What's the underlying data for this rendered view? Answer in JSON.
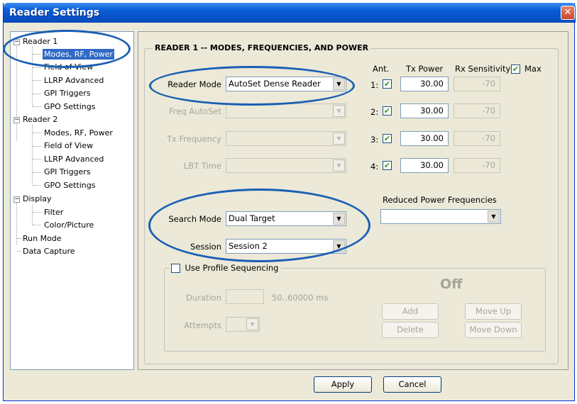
{
  "window": {
    "title": "Reader Settings",
    "close_glyph": "✕"
  },
  "tree": {
    "items": [
      {
        "label": "Reader 1",
        "expander": "−"
      },
      {
        "label": "Modes, RF, Power"
      },
      {
        "label": "Field of View"
      },
      {
        "label": "LLRP Advanced"
      },
      {
        "label": "GPI Triggers"
      },
      {
        "label": "GPO Settings"
      },
      {
        "label": "Reader 2",
        "expander": "−"
      },
      {
        "label": "Modes, RF, Power"
      },
      {
        "label": "Field of View"
      },
      {
        "label": "LLRP Advanced"
      },
      {
        "label": "GPI Triggers"
      },
      {
        "label": "GPO Settings"
      },
      {
        "label": "Display",
        "expander": "−"
      },
      {
        "label": "Filter"
      },
      {
        "label": "Color/Picture"
      },
      {
        "label": "Run Mode"
      },
      {
        "label": "Data Capture"
      }
    ],
    "selected": "Modes, RF, Power"
  },
  "group": {
    "title": "READER 1 -- MODES, FREQUENCIES, AND POWER"
  },
  "form": {
    "reader_mode": {
      "label": "Reader Mode",
      "value": "AutoSet Dense Reader"
    },
    "freq_autoset": {
      "label": "Freq AutoSet",
      "value": ""
    },
    "tx_frequency": {
      "label": "Tx Frequency",
      "value": ""
    },
    "lbt_time": {
      "label": "LBT Time",
      "value": ""
    },
    "search_mode": {
      "label": "Search Mode",
      "value": "Dual Target"
    },
    "session": {
      "label": "Session",
      "value": "Session 2"
    }
  },
  "antennas": {
    "header_ant": "Ant.",
    "header_tx": "Tx Power",
    "header_rx": "Rx Sensitivity",
    "max_label": "Max",
    "max_checked": true,
    "rows": [
      {
        "num": "1:",
        "checked": true,
        "tx": "30.00",
        "rx": "-70"
      },
      {
        "num": "2:",
        "checked": true,
        "tx": "30.00",
        "rx": "-70"
      },
      {
        "num": "3:",
        "checked": true,
        "tx": "30.00",
        "rx": "-70"
      },
      {
        "num": "4:",
        "checked": true,
        "tx": "30.00",
        "rx": "-70"
      }
    ]
  },
  "reduced_power": {
    "label": "Reduced Power Frequencies",
    "value": ""
  },
  "profile": {
    "checkbox_label": "Use Profile Sequencing",
    "checked": false,
    "duration_label": "Duration",
    "duration_hint": "50..60000 ms",
    "attempts_label": "Attempts",
    "status": "Off",
    "add": "Add",
    "delete": "Delete",
    "move_up": "Move Up",
    "move_down": "Move Down"
  },
  "footer": {
    "apply": "Apply",
    "cancel": "Cancel"
  },
  "glyphs": {
    "check": "✔",
    "arrow": "▼"
  },
  "colors": {
    "accent": "#1a5fb4",
    "selection": "#316ac5",
    "title_bar": "#0a5fd8"
  }
}
